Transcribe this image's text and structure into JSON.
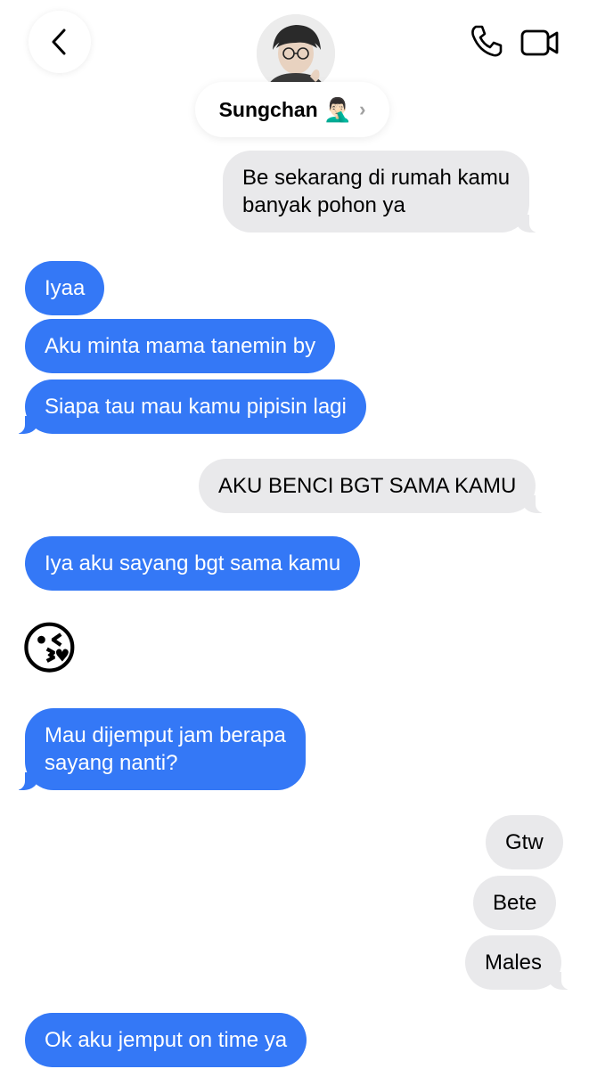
{
  "contact": {
    "name": "Sungchan",
    "emoji": "🤦🏻‍♂️",
    "chevron": "›"
  },
  "icons": {
    "back": "chevron-left",
    "call": "phone",
    "video": "video-camera"
  },
  "colors": {
    "incoming_bubble": "#3478f6",
    "outgoing_bubble": "#e9e9eb",
    "background": "#ffffff"
  },
  "messages": [
    {
      "from": "me",
      "text": "Be sekarang di rumah kamu\nbanyak pohon ya"
    },
    {
      "from": "them",
      "text": "Iyaa"
    },
    {
      "from": "them",
      "text": "Aku minta mama tanemin by"
    },
    {
      "from": "them",
      "text": "Siapa tau mau kamu pipisin lagi"
    },
    {
      "from": "me",
      "text": "AKU BENCI BGT SAMA KAMU"
    },
    {
      "from": "them",
      "text": "Iya aku sayang bgt sama kamu"
    },
    {
      "from": "them",
      "text": "😘"
    },
    {
      "from": "them",
      "text": "Mau dijemput jam berapa\nsayang nanti?"
    },
    {
      "from": "me",
      "text": "Gtw"
    },
    {
      "from": "me",
      "text": "Bete"
    },
    {
      "from": "me",
      "text": "Males"
    },
    {
      "from": "them",
      "text": "Ok aku jemput on time ya"
    }
  ]
}
